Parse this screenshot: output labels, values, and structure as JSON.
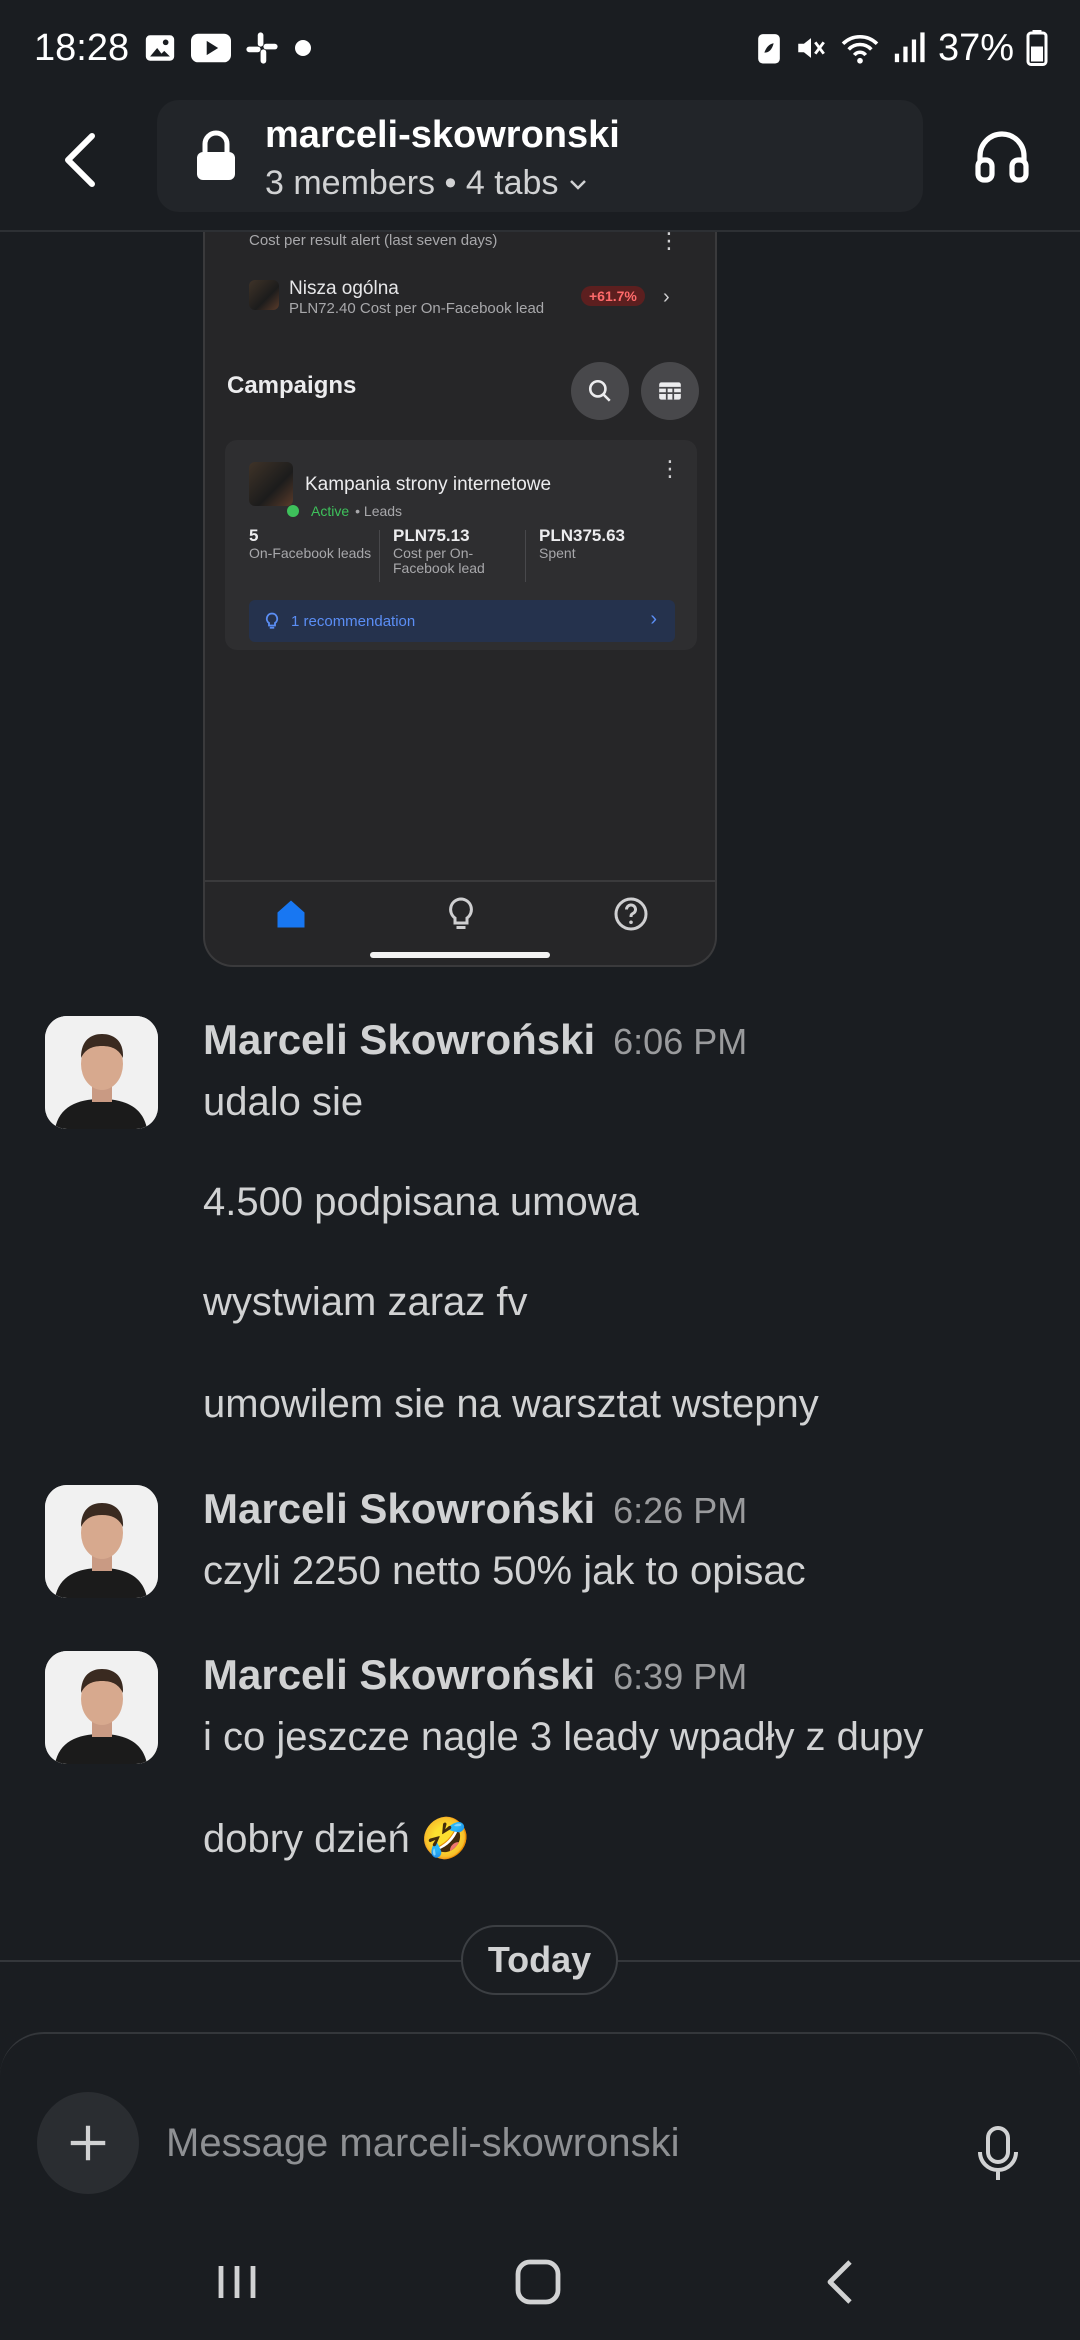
{
  "status_bar": {
    "time": "18:28",
    "battery": "37%"
  },
  "header": {
    "channel_name": "marceli-skowronski",
    "meta": "3 members • 4 tabs"
  },
  "shared_image": {
    "alert_title": "Cost per result alert (last seven days)",
    "nisza_name": "Nisza ogólna",
    "nisza_sub": "PLN72.40 Cost per On-Facebook lead",
    "nisza_badge": "+61.7%",
    "campaigns_heading": "Campaigns",
    "campaign_name": "Kampania strony internetowe",
    "campaign_status": "Active",
    "campaign_type": "• Leads",
    "metrics": [
      {
        "value": "5",
        "label": "On-Facebook leads"
      },
      {
        "value": "PLN75.13",
        "label": "Cost per On-Facebook lead"
      },
      {
        "value": "PLN375.63",
        "label": "Spent"
      }
    ],
    "recommendation": "1 recommendation"
  },
  "messages": [
    {
      "sender": "Marceli Skowroński",
      "time": "6:06 PM",
      "lines": [
        "udalo sie",
        "4.500 podpisana umowa",
        "wystwiam zaraz fv",
        "umowilem sie na warsztat wstepny"
      ]
    },
    {
      "sender": "Marceli Skowroński",
      "time": "6:26 PM",
      "lines": [
        "czyli 2250 netto 50% jak to opisac"
      ]
    },
    {
      "sender": "Marceli Skowroński",
      "time": "6:39 PM",
      "lines": [
        "i co jeszcze nagle 3 leady wpadły z dupy",
        "dobry dzień 🤣"
      ]
    }
  ],
  "divider": {
    "label": "Today"
  },
  "composer": {
    "placeholder": "Message marceli-skowronski"
  },
  "colors": {
    "background": "#1a1d21",
    "text": "#d1d2d3",
    "accent_blue": "#1877f2"
  }
}
